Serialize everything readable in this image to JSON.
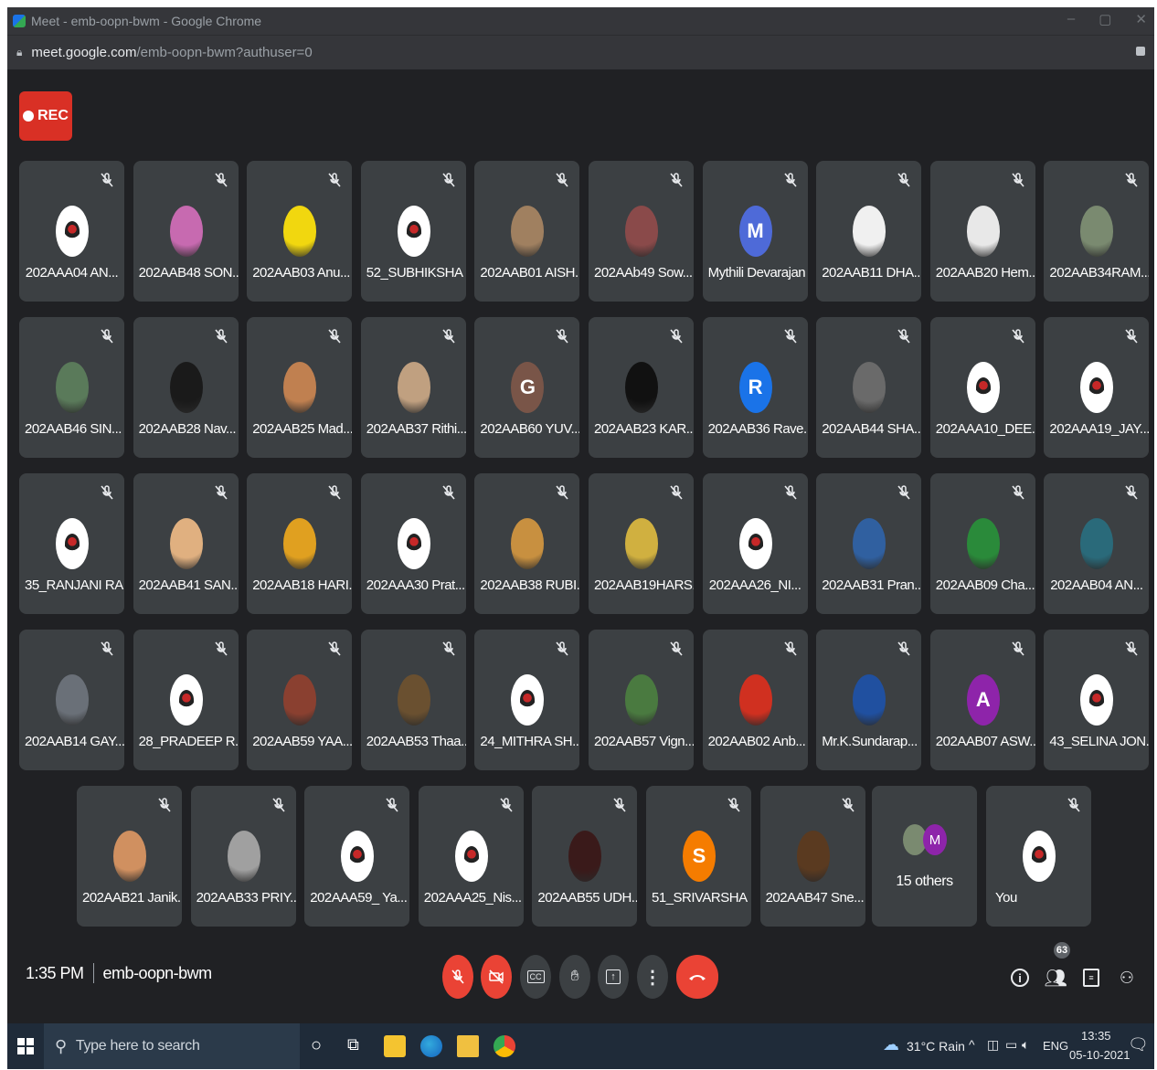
{
  "browser": {
    "title": "Meet - emb-oopn-bwm - Google Chrome",
    "url_domain": "meet.google.com",
    "url_path": "/emb-oopn-bwm?authuser=0"
  },
  "rec_label": "REC",
  "participants": [
    {
      "name": "202AAA04 AN...",
      "avatar": "logo"
    },
    {
      "name": "202AAB48 SON...",
      "avatar": "photo",
      "color": "#c76ab0"
    },
    {
      "name": "202AAB03 Anu...",
      "avatar": "photo",
      "color": "#f1d70f"
    },
    {
      "name": "52_SUBHIKSHA ...",
      "avatar": "logo"
    },
    {
      "name": "202AAB01 AISH...",
      "avatar": "photo",
      "color": "#a08060"
    },
    {
      "name": "202AAb49 Sow...",
      "avatar": "photo",
      "color": "#8a4a4a"
    },
    {
      "name": "Mythili Devarajan",
      "avatar": "letter",
      "letter": "M",
      "color": "#4e6ad8"
    },
    {
      "name": "202AAB11 DHA...",
      "avatar": "photo",
      "color": "#f0f0f0"
    },
    {
      "name": "202AAB20 Hem...",
      "avatar": "photo",
      "color": "#e8e8e8"
    },
    {
      "name": "202AAB34RAM...",
      "avatar": "photo",
      "color": "#7a8a70"
    },
    {
      "name": "202AAB46 SIN...",
      "avatar": "photo",
      "color": "#5a7a5a"
    },
    {
      "name": "202AAB28 Nav...",
      "avatar": "photo",
      "color": "#1a1a1a"
    },
    {
      "name": "202AAB25 Mad...",
      "avatar": "photo",
      "color": "#c08050"
    },
    {
      "name": "202AAB37 Rithi...",
      "avatar": "photo",
      "color": "#c0a080"
    },
    {
      "name": "202AAB60 YUV...",
      "avatar": "letter",
      "letter": "G",
      "color": "#795548"
    },
    {
      "name": "202AAB23 KAR...",
      "avatar": "photo",
      "color": "#111111"
    },
    {
      "name": "202AAB36 Rave...",
      "avatar": "letter",
      "letter": "R",
      "color": "#1a73e8"
    },
    {
      "name": "202AAB44 SHA...",
      "avatar": "photo",
      "color": "#6a6a6a"
    },
    {
      "name": "202AAA10_DEE...",
      "avatar": "logo"
    },
    {
      "name": "202AAA19_JAY...",
      "avatar": "logo"
    },
    {
      "name": "35_RANJANI RA...",
      "avatar": "logo"
    },
    {
      "name": "202AAB41 SAN...",
      "avatar": "photo",
      "color": "#e0b080"
    },
    {
      "name": "202AAB18 HARI...",
      "avatar": "photo",
      "color": "#e0a020"
    },
    {
      "name": "202AAA30 Prat...",
      "avatar": "logo"
    },
    {
      "name": "202AAB38 RUBI...",
      "avatar": "photo",
      "color": "#c89040"
    },
    {
      "name": "202AAB19HARS...",
      "avatar": "photo",
      "color": "#d0b040"
    },
    {
      "name": "202AAA26_NI...",
      "avatar": "logo"
    },
    {
      "name": "202AAB31 Pran...",
      "avatar": "photo",
      "color": "#3060a0"
    },
    {
      "name": "202AAB09 Cha...",
      "avatar": "photo",
      "color": "#2a8a3a"
    },
    {
      "name": "202AAB04 AN...",
      "avatar": "photo",
      "color": "#2a6a7a"
    },
    {
      "name": "202AAB14 GAY...",
      "avatar": "photo",
      "color": "#6a7078"
    },
    {
      "name": "28_PRADEEP R...",
      "avatar": "logo"
    },
    {
      "name": "202AAB59 YAA...",
      "avatar": "photo",
      "color": "#8a4030"
    },
    {
      "name": "202AAB53 Thaa...",
      "avatar": "photo",
      "color": "#6a5030"
    },
    {
      "name": "24_MITHRA SH...",
      "avatar": "logo"
    },
    {
      "name": "202AAB57 Vign...",
      "avatar": "photo",
      "color": "#4a7a40"
    },
    {
      "name": "202AAB02 Anb...",
      "avatar": "photo",
      "color": "#d03020"
    },
    {
      "name": "Mr.K.Sundarap...",
      "avatar": "photo",
      "color": "#2050a0"
    },
    {
      "name": "202AAB07 ASW...",
      "avatar": "letter",
      "letter": "A",
      "color": "#8e24aa"
    },
    {
      "name": "43_SELINA JON...",
      "avatar": "logo"
    },
    {
      "name": "202AAB21 Janik...",
      "avatar": "photo",
      "color": "#d09060"
    },
    {
      "name": "202AAB33 PRIY...",
      "avatar": "photo",
      "color": "#a0a0a0"
    },
    {
      "name": "202AAA59_ Ya...",
      "avatar": "logo"
    },
    {
      "name": "202AAA25_Nis...",
      "avatar": "logo"
    },
    {
      "name": "202AAB55 UDH...",
      "avatar": "photo",
      "color": "#3a1a1a"
    },
    {
      "name": "51_SRIVARSHA",
      "avatar": "letter",
      "letter": "S",
      "color": "#f57c00"
    },
    {
      "name": "202AAB47 Sne...",
      "avatar": "photo",
      "color": "#5a3a20"
    }
  ],
  "others_tile": {
    "label": "15 others",
    "letter": "M",
    "color": "#8e24aa"
  },
  "self_tile": {
    "label": "You"
  },
  "meeting": {
    "time": "1:35 PM",
    "code": "emb-oopn-bwm",
    "participant_count": "63"
  },
  "colors": {
    "accent_red": "#ea4335",
    "tile_bg": "#3c4043",
    "page_bg": "#202124"
  },
  "taskbar": {
    "search_placeholder": "Type here to search",
    "weather": "31°C Rain",
    "language": "ENG",
    "clock_time": "13:35",
    "clock_date": "05-10-2021"
  }
}
